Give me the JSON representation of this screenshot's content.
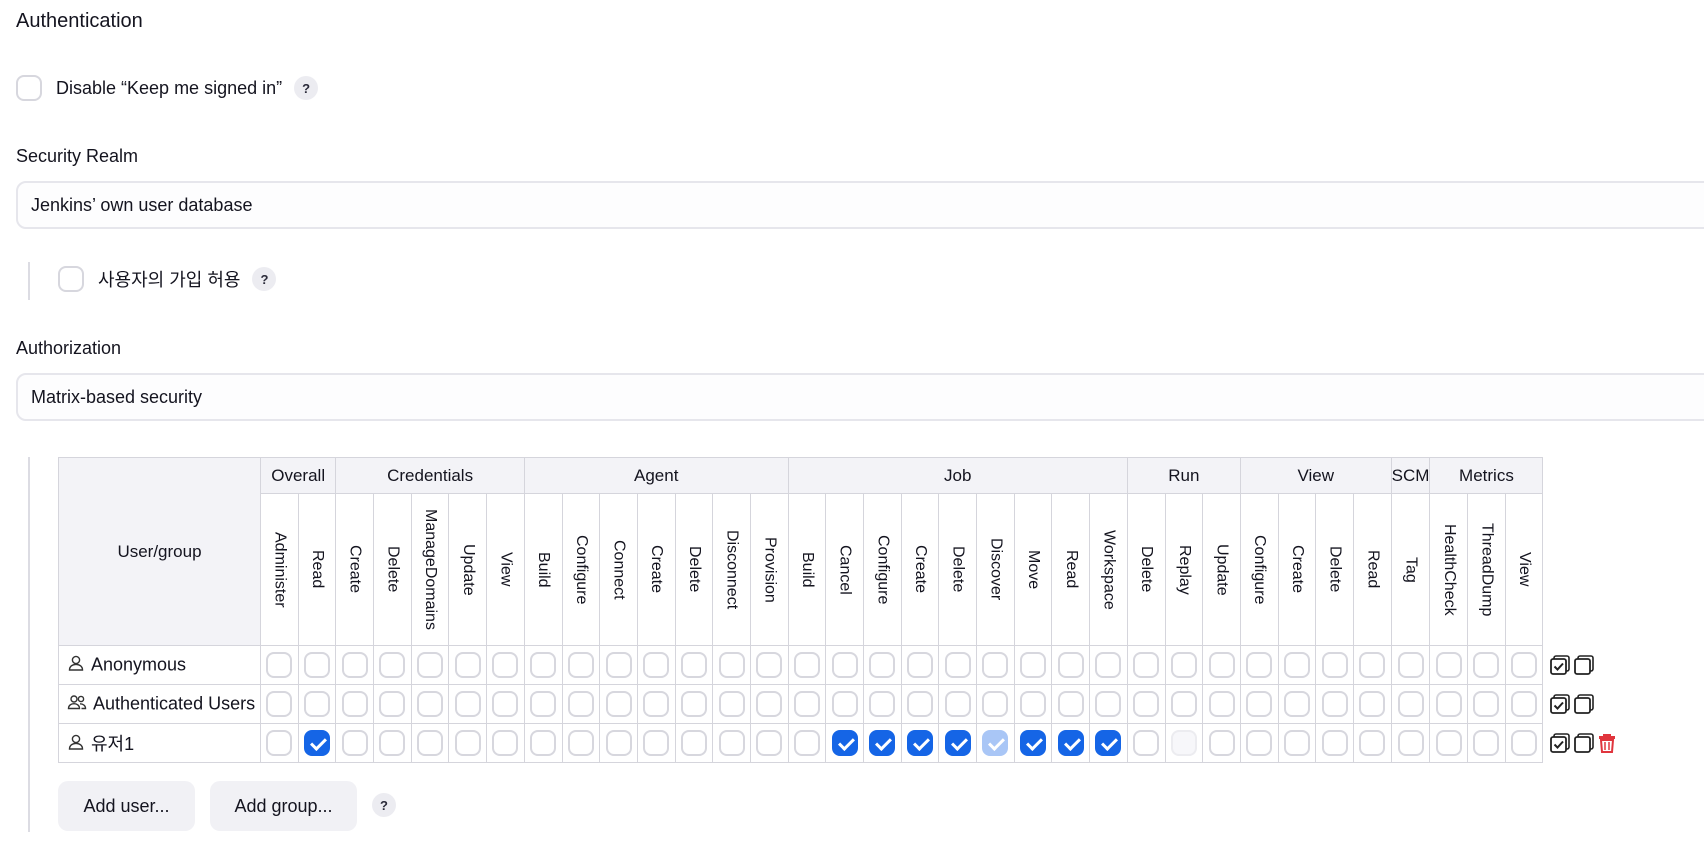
{
  "section_title": "Authentication",
  "keep_signed_in": {
    "label": "Disable “Keep me signed in”",
    "checked": false,
    "help": "?"
  },
  "security_realm": {
    "label": "Security Realm",
    "value": "Jenkins’ own user database"
  },
  "allow_signup": {
    "label": "사용자의 가입 허용",
    "checked": false,
    "help": "?"
  },
  "authorization": {
    "label": "Authorization",
    "value": "Matrix-based security"
  },
  "matrix": {
    "user_group_header": "User/group",
    "groups": [
      {
        "name": "Overall",
        "permissions": [
          "Administer",
          "Read"
        ]
      },
      {
        "name": "Credentials",
        "permissions": [
          "Create",
          "Delete",
          "ManageDomains",
          "Update",
          "View"
        ]
      },
      {
        "name": "Agent",
        "permissions": [
          "Build",
          "Configure",
          "Connect",
          "Create",
          "Delete",
          "Disconnect",
          "Provision"
        ]
      },
      {
        "name": "Job",
        "permissions": [
          "Build",
          "Cancel",
          "Configure",
          "Create",
          "Delete",
          "Discover",
          "Move",
          "Read",
          "Workspace"
        ]
      },
      {
        "name": "Run",
        "permissions": [
          "Delete",
          "Replay",
          "Update"
        ]
      },
      {
        "name": "View",
        "permissions": [
          "Configure",
          "Create",
          "Delete",
          "Read"
        ]
      },
      {
        "name": "SCM",
        "permissions": [
          "Tag"
        ]
      },
      {
        "name": "Metrics",
        "permissions": [
          "HealthCheck",
          "ThreadDump",
          "View"
        ]
      }
    ],
    "rows": [
      {
        "name": "Anonymous",
        "icon": "user-icon",
        "checked": [],
        "implied": [],
        "disabled": [],
        "deletable": false
      },
      {
        "name": "Authenticated Users",
        "icon": "group-icon",
        "checked": [],
        "implied": [],
        "disabled": [],
        "deletable": false
      },
      {
        "name": "유저1",
        "icon": "user-icon",
        "checked": [
          1,
          15,
          16,
          17,
          18,
          20,
          21,
          22
        ],
        "implied": [
          19
        ],
        "disabled": [
          24
        ],
        "deletable": true
      }
    ]
  },
  "buttons": {
    "add_user": "Add user...",
    "add_group": "Add group...",
    "help": "?"
  },
  "colors": {
    "accent": "#1565e6",
    "implied": "#a9c6f6",
    "delete": "#e0353d"
  }
}
